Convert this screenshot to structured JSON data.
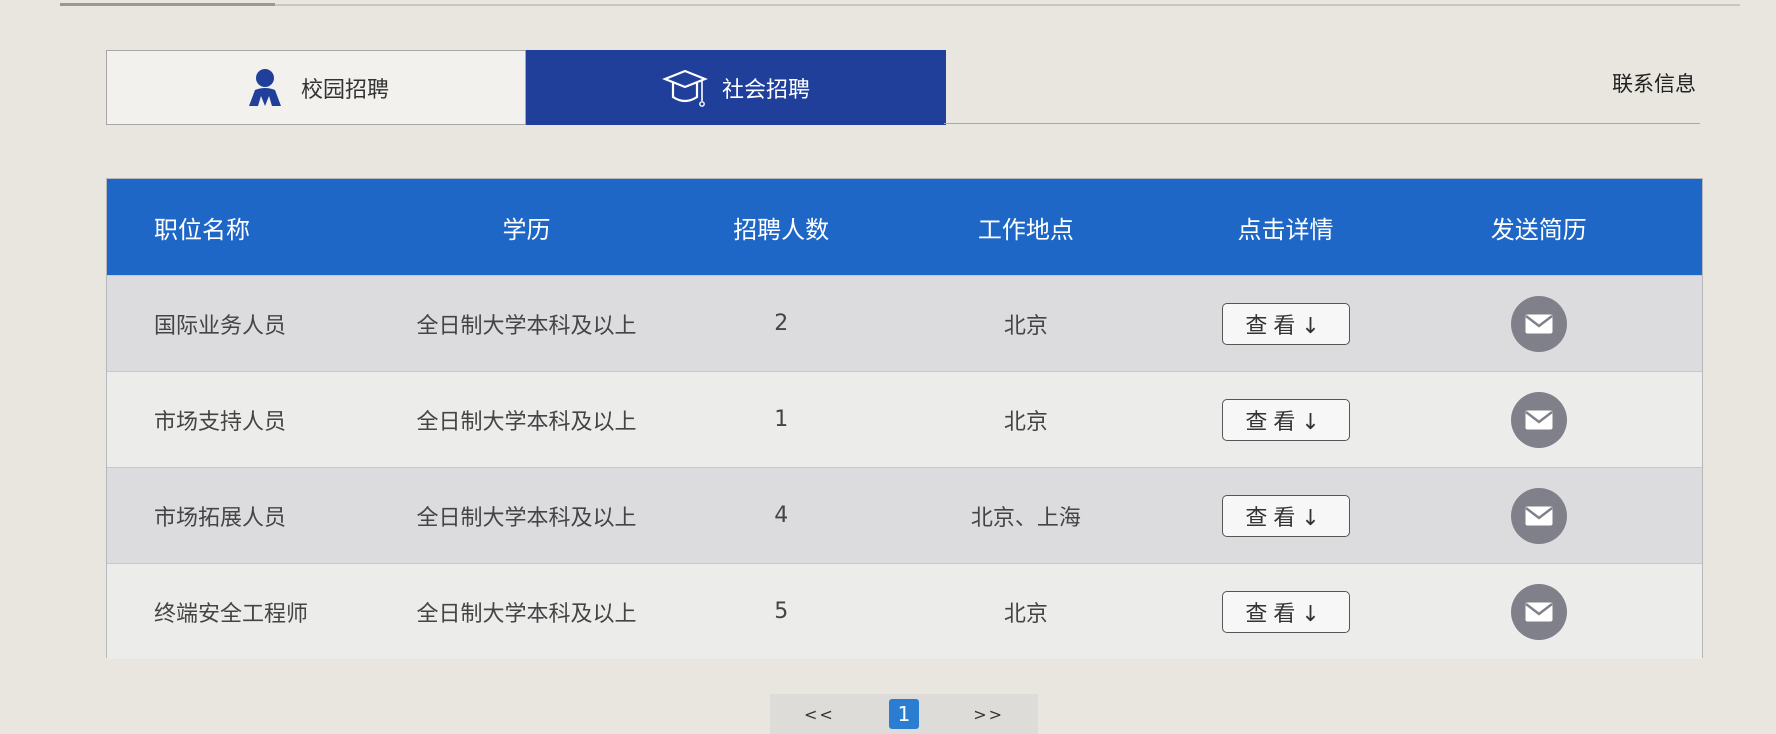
{
  "tabs": [
    {
      "label": "校园招聘",
      "icon": "person-icon",
      "active": false
    },
    {
      "label": "社会招聘",
      "icon": "graduation-cap-icon",
      "active": true
    }
  ],
  "contact_label": "联系信息",
  "table": {
    "headers": [
      "职位名称",
      "学历",
      "招聘人数",
      "工作地点",
      "点击详情",
      "发送简历"
    ],
    "rows": [
      {
        "title": "国际业务人员",
        "education": "全日制大学本科及以上",
        "count": "2",
        "location": "北京",
        "view": "查看↓",
        "send_icon": "mail-icon"
      },
      {
        "title": "市场支持人员",
        "education": "全日制大学本科及以上",
        "count": "1",
        "location": "北京",
        "view": "查看↓",
        "send_icon": "mail-icon"
      },
      {
        "title": "市场拓展人员",
        "education": "全日制大学本科及以上",
        "count": "4",
        "location": "北京、上海",
        "view": "查看↓",
        "send_icon": "mail-icon"
      },
      {
        "title": "终端安全工程师",
        "education": "全日制大学本科及以上",
        "count": "5",
        "location": "北京",
        "view": "查看↓",
        "send_icon": "mail-icon"
      }
    ]
  },
  "pagination": {
    "prev": "<<",
    "current": "1",
    "next": ">>"
  },
  "colors": {
    "tab_active": "#1f3f9a",
    "header_bg": "#1f67c7",
    "page_active": "#2b7dd1",
    "mail_icon": "#7f8089"
  }
}
